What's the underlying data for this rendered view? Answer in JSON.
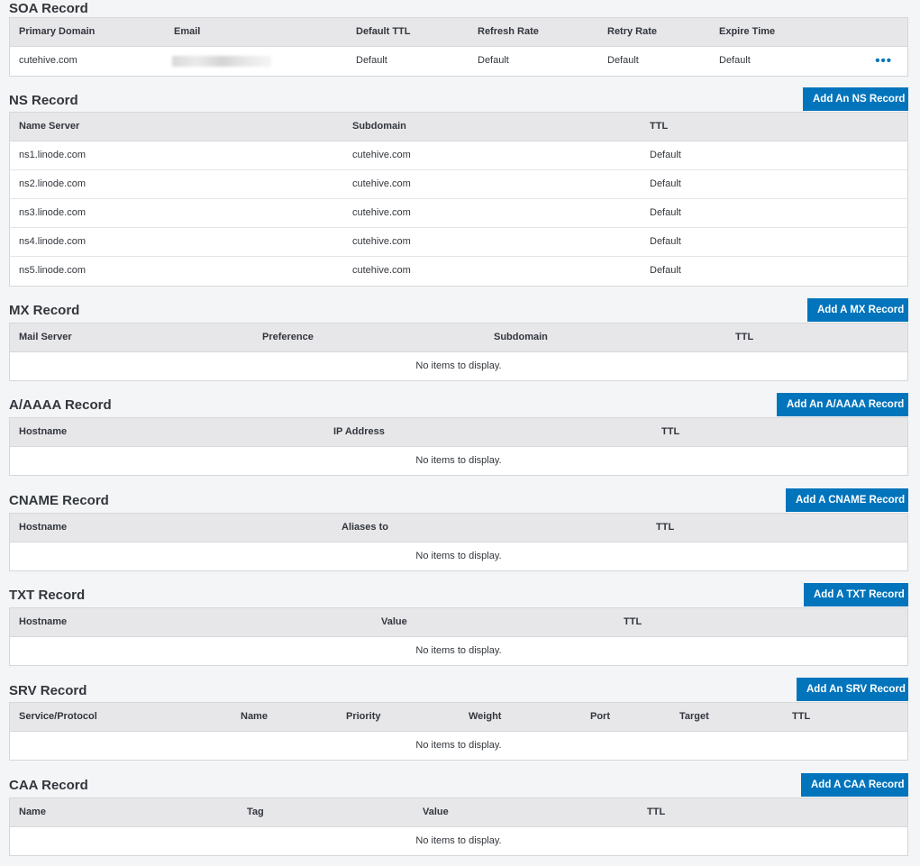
{
  "soa": {
    "title": "SOA Record",
    "headers": [
      "Primary Domain",
      "Email",
      "Default TTL",
      "Refresh Rate",
      "Retry Rate",
      "Expire Time"
    ],
    "row": {
      "primary_domain": "cutehive.com",
      "default_ttl": "Default",
      "refresh_rate": "Default",
      "retry_rate": "Default",
      "expire_time": "Default"
    },
    "more_label": "•••"
  },
  "ns": {
    "title": "NS Record",
    "add_label": "Add An NS Record",
    "headers": [
      "Name Server",
      "Subdomain",
      "TTL"
    ],
    "rows": [
      [
        "ns1.linode.com",
        "cutehive.com",
        "Default"
      ],
      [
        "ns2.linode.com",
        "cutehive.com",
        "Default"
      ],
      [
        "ns3.linode.com",
        "cutehive.com",
        "Default"
      ],
      [
        "ns4.linode.com",
        "cutehive.com",
        "Default"
      ],
      [
        "ns5.linode.com",
        "cutehive.com",
        "Default"
      ]
    ]
  },
  "mx": {
    "title": "MX Record",
    "add_label": "Add A MX Record",
    "headers": [
      "Mail Server",
      "Preference",
      "Subdomain",
      "TTL"
    ],
    "empty": "No items to display."
  },
  "a": {
    "title": "A/AAAA Record",
    "add_label": "Add An A/AAAA Record",
    "headers": [
      "Hostname",
      "IP Address",
      "TTL"
    ],
    "empty": "No items to display."
  },
  "cname": {
    "title": "CNAME Record",
    "add_label": "Add A CNAME Record",
    "headers": [
      "Hostname",
      "Aliases to",
      "TTL"
    ],
    "empty": "No items to display."
  },
  "txt": {
    "title": "TXT Record",
    "add_label": "Add A TXT Record",
    "headers": [
      "Hostname",
      "Value",
      "TTL"
    ],
    "empty": "No items to display."
  },
  "srv": {
    "title": "SRV Record",
    "add_label": "Add An SRV Record",
    "headers": [
      "Service/Protocol",
      "Name",
      "Priority",
      "Weight",
      "Port",
      "Target",
      "TTL"
    ],
    "empty": "No items to display."
  },
  "caa": {
    "title": "CAA Record",
    "add_label": "Add A CAA Record",
    "headers": [
      "Name",
      "Tag",
      "Value",
      "TTL"
    ],
    "empty": "No items to display."
  },
  "colors": {
    "accent": "#0174bc",
    "header_bg": "#e7e7ea",
    "page_bg": "#f4f5f6"
  }
}
